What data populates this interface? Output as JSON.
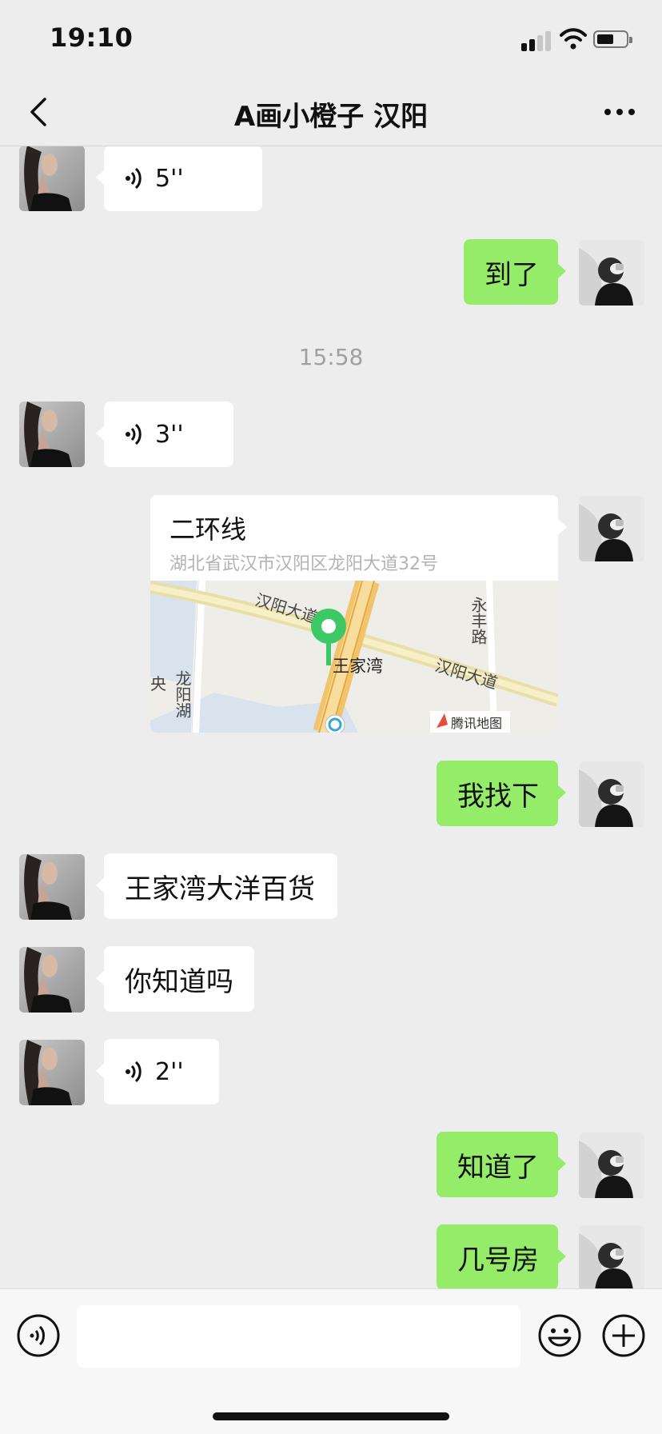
{
  "status_bar": {
    "time": "19:10",
    "signal_bars": 2,
    "battery_level": 0.5
  },
  "header": {
    "title": "A画小橙子 汉阳",
    "back_icon": "chevron-left-icon",
    "more_icon": "more-dots-icon"
  },
  "messages": [
    {
      "sender": "other",
      "type": "voice",
      "duration": "5''"
    },
    {
      "sender": "me",
      "type": "text",
      "text": "到了"
    },
    {
      "type": "timestamp",
      "text": "15:58"
    },
    {
      "sender": "other",
      "type": "voice",
      "duration": "3''"
    },
    {
      "sender": "me",
      "type": "location",
      "name": "二环线",
      "address": "湖北省武汉市汉阳区龙阳大道32号",
      "map": {
        "road_label_1": "汉阳大道",
        "road_label_2": "汉阳大道",
        "road_label_3": "永丰路",
        "road_label_4": "龙阳湖",
        "edge_label": "央",
        "place_label": "王家湾",
        "provider": "腾讯地图"
      }
    },
    {
      "sender": "me",
      "type": "text",
      "text": "我找下"
    },
    {
      "sender": "other",
      "type": "text",
      "text": "王家湾大洋百货"
    },
    {
      "sender": "other",
      "type": "text",
      "text": "你知道吗"
    },
    {
      "sender": "other",
      "type": "voice",
      "duration": "2''"
    },
    {
      "sender": "me",
      "type": "text",
      "text": "知道了"
    },
    {
      "sender": "me",
      "type": "text",
      "text": "几号房"
    }
  ],
  "input_bar": {
    "placeholder": "",
    "voice_icon": "voice-input-icon",
    "emoji_icon": "emoji-icon",
    "plus_icon": "plus-icon"
  },
  "colors": {
    "background": "#ededed",
    "outgoing_bubble": "#95ec69",
    "incoming_bubble": "#ffffff",
    "map_pin": "#3cc864"
  }
}
